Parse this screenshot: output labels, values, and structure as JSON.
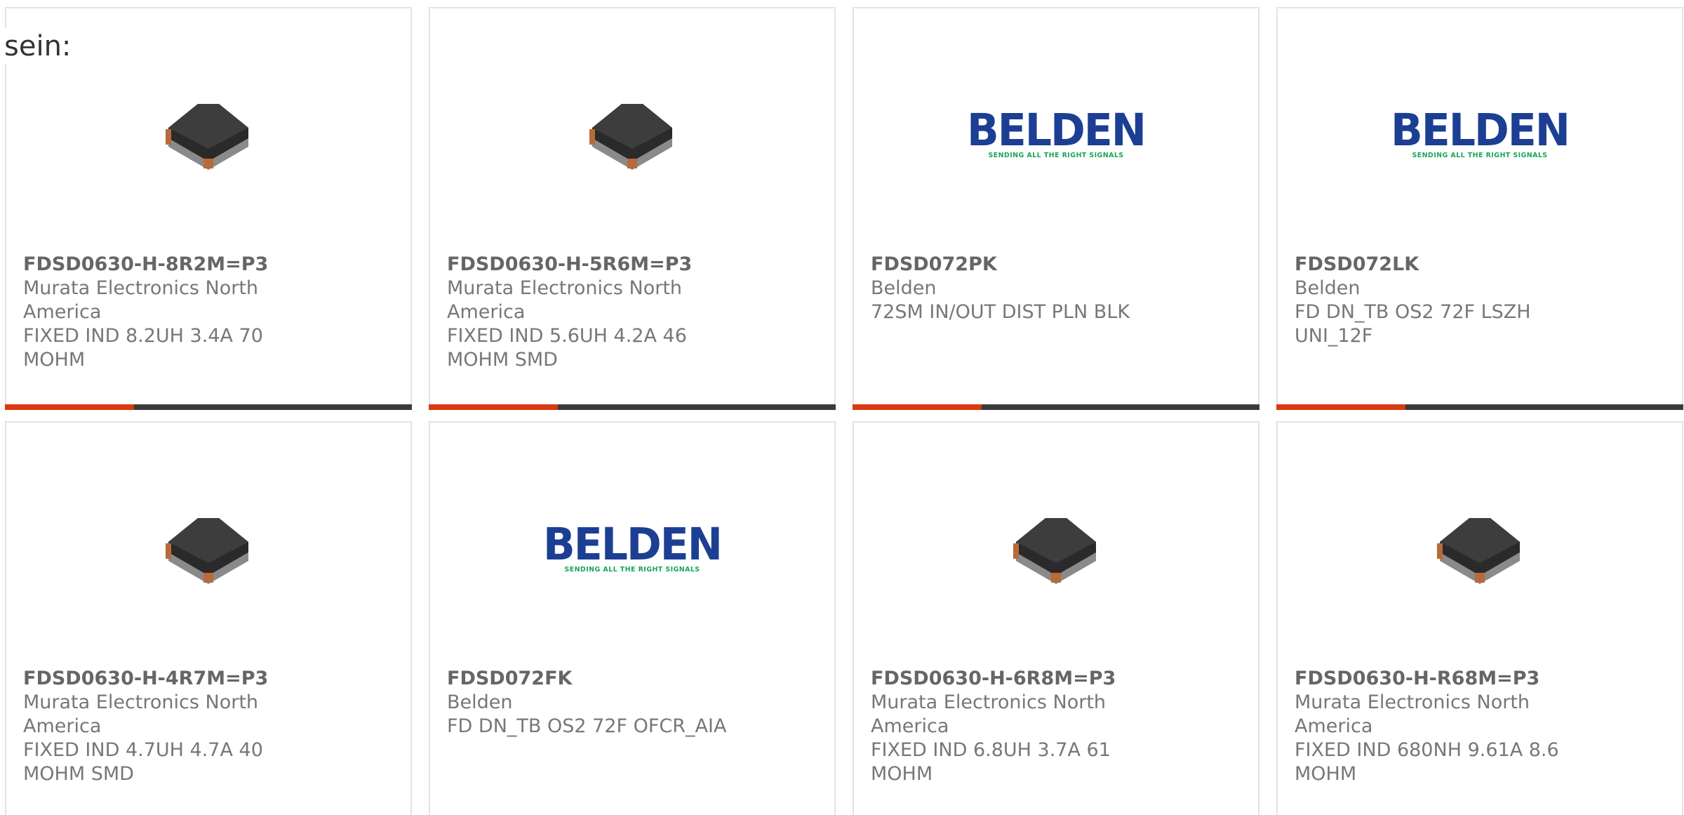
{
  "intro_text": "sein:",
  "colors": {
    "accent": "#d83a12",
    "bar": "#3a3a3a",
    "border": "#e3e3e3",
    "belden_blue": "#1c3f94",
    "belden_green": "#1aa55a"
  },
  "products": [
    {
      "part_number": "FDSD0630-H-8R2M=P3",
      "manufacturer": "Murata Electronics North America",
      "description": "FIXED IND 8.2UH 3.4A 70 MOHM",
      "image": "inductor-chip-image"
    },
    {
      "part_number": "FDSD0630-H-5R6M=P3",
      "manufacturer": "Murata Electronics North America",
      "description": "FIXED IND 5.6UH 4.2A 46 MOHM SMD",
      "image": "inductor-chip-image"
    },
    {
      "part_number": "FDSD072PK",
      "manufacturer": "Belden",
      "description": "72SM IN/OUT DIST PLN BLK",
      "image": "belden-logo"
    },
    {
      "part_number": "FDSD072LK",
      "manufacturer": "Belden",
      "description": "FD DN_TB OS2 72F LSZH UNI_12F",
      "image": "belden-logo"
    },
    {
      "part_number": "FDSD0630-H-4R7M=P3",
      "manufacturer": "Murata Electronics North America",
      "description": "FIXED IND 4.7UH 4.7A 40 MOHM SMD",
      "image": "inductor-chip-image"
    },
    {
      "part_number": "FDSD072FK",
      "manufacturer": "Belden",
      "description": "FD DN_TB OS2 72F OFCR_AIA",
      "image": "belden-logo"
    },
    {
      "part_number": "FDSD0630-H-6R8M=P3",
      "manufacturer": "Murata Electronics North America",
      "description": "FIXED IND 6.8UH 3.7A 61 MOHM",
      "image": "inductor-chip-image"
    },
    {
      "part_number": "FDSD0630-H-R68M=P3",
      "manufacturer": "Murata Electronics North America",
      "description": "FIXED IND 680NH 9.61A 8.6 MOHM",
      "image": "inductor-chip-image"
    }
  ],
  "belden_logo": {
    "word": "BELDEN",
    "tagline": "SENDING ALL THE RIGHT SIGNALS"
  }
}
